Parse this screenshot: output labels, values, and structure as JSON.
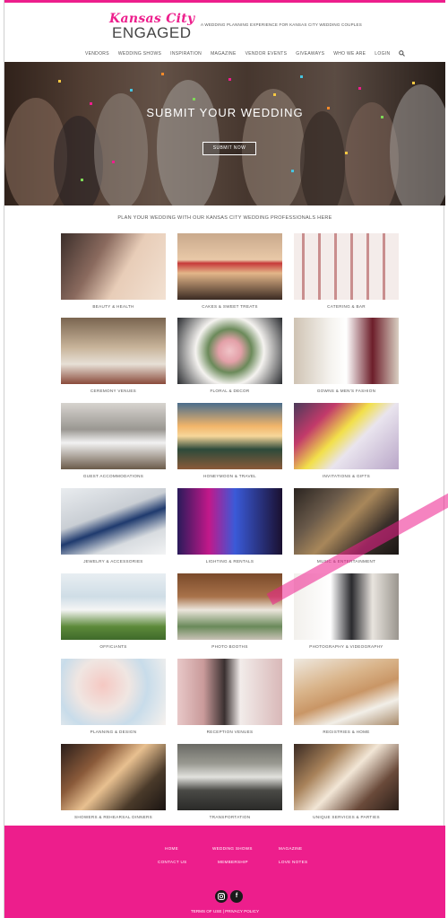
{
  "header": {
    "logo_script": "Kansas City",
    "logo_main": "ENGAGED",
    "tagline": "A WEDDING PLANNING EXPERIENCE FOR KANSAS CITY WEDDING COUPLES",
    "nav": [
      "VENDORS",
      "WEDDING SHOWS",
      "INSPIRATION",
      "MAGAZINE",
      "VENDOR EVENTS",
      "GIVEAWAYS",
      "WHO WE ARE",
      "LOGIN"
    ]
  },
  "hero": {
    "title": "SUBMIT YOUR WEDDING",
    "button": "SUBMIT NOW"
  },
  "intro": "PLAN YOUR WEDDING WITH OUR KANSAS CITY WEDDING PROFESSIONALS HERE",
  "categories": [
    "BEAUTY & HEALTH",
    "CAKES & SWEET TREATS",
    "CATERING & BAR",
    "CEREMONY VENUES",
    "FLORAL & DECOR",
    "GOWNS & MEN'S FASHION",
    "GUEST ACCOMMODATIONS",
    "HONEYMOON & TRAVEL",
    "INVITATIONS & GIFTS",
    "JEWELRY & ACCESSORIES",
    "LIGHTING & RENTALS",
    "MUSIC & ENTERTAINMENT",
    "OFFICIANTS",
    "PHOTO BOOTHS",
    "PHOTOGRAPHY & VIDEOGRAPHY",
    "PLANNING & DESIGN",
    "RECEPTION VENUES",
    "REGISTRIES & HOME",
    "SHOWERS & REHEARSAL DINNERS",
    "TRANSPORTATION",
    "UNIQUE SERVICES & PARTIES"
  ],
  "footer": {
    "links_row1": [
      "HOME",
      "WEDDING SHOWS",
      "MAGAZINE"
    ],
    "links_row2": [
      "CONTACT US",
      "MEMBERSHIP",
      "LOVE NOTES"
    ],
    "legal": "TERMS OF USE | PRIVACY POLICY"
  },
  "icons": {
    "search": "search-icon",
    "instagram": "instagram-icon",
    "facebook": "facebook-icon"
  },
  "colors": {
    "accent": "#ed1e8c",
    "text": "#555555"
  }
}
